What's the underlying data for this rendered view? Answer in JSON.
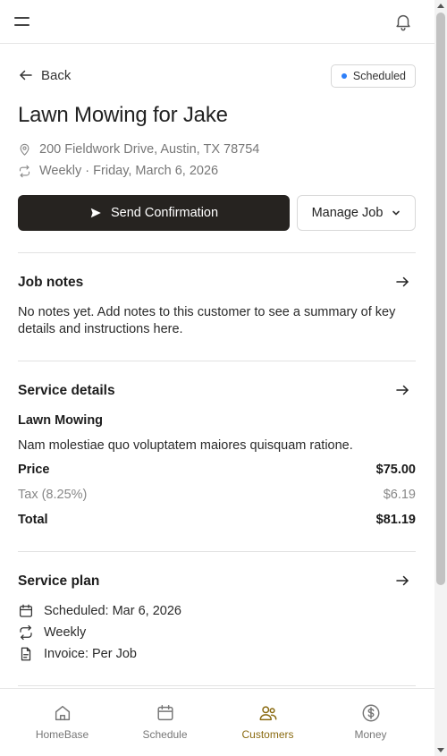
{
  "topbar": {
    "menu_icon": "menu-icon",
    "bell_icon": "bell-icon"
  },
  "header": {
    "back_label": "Back",
    "status_badge": "Scheduled",
    "title": "Lawn Mowing for Jake",
    "address": "200 Fieldwork Drive, Austin, TX 78754",
    "frequency": "Weekly · Friday, March 6, 2026"
  },
  "actions": {
    "send_confirmation": "Send Confirmation",
    "manage_job": "Manage Job"
  },
  "job_notes": {
    "title": "Job notes",
    "text": "No notes yet. Add notes to this customer to see a summary of key details and instructions here."
  },
  "service_details": {
    "title": "Service details",
    "service_name": "Lawn Mowing",
    "description": "Nam molestiae quo voluptatem maiores quisquam ratione.",
    "price_label": "Price",
    "price_value": "$75.00",
    "tax_label": "Tax (8.25%)",
    "tax_value": "$6.19",
    "total_label": "Total",
    "total_value": "$81.19"
  },
  "service_plan": {
    "title": "Service plan",
    "scheduled": "Scheduled: Mar 6, 2026",
    "frequency": "Weekly",
    "invoice": "Invoice: Per Job"
  },
  "bottom_nav": {
    "items": [
      {
        "label": "HomeBase",
        "icon": "home-icon"
      },
      {
        "label": "Schedule",
        "icon": "calendar-icon"
      },
      {
        "label": "Customers",
        "icon": "users-icon"
      },
      {
        "label": "Money",
        "icon": "dollar-icon"
      }
    ],
    "active": "Customers"
  },
  "colors": {
    "primary_button": "#262320",
    "status_dot": "#2d7ff9",
    "nav_active": "#8a6a10"
  }
}
